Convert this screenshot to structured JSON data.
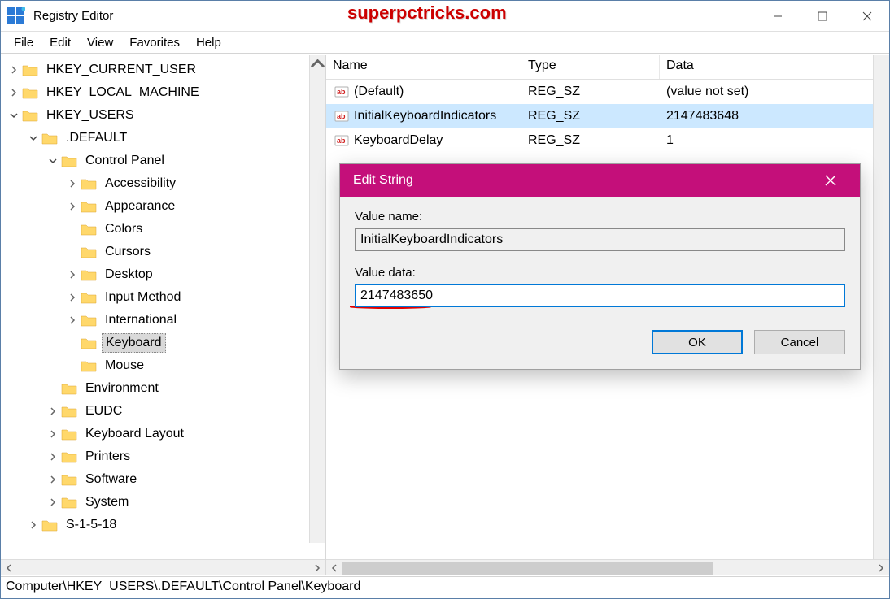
{
  "header": {
    "title": "Registry Editor",
    "watermark": "superpctricks.com"
  },
  "menu": {
    "file": "File",
    "edit": "Edit",
    "view": "View",
    "favorites": "Favorites",
    "help": "Help"
  },
  "tree": {
    "hkcu": "HKEY_CURRENT_USER",
    "hklm": "HKEY_LOCAL_MACHINE",
    "hku": "HKEY_USERS",
    "default": ".DEFAULT",
    "cp": "Control Panel",
    "cp_items": [
      "Accessibility",
      "Appearance",
      "Colors",
      "Cursors",
      "Desktop",
      "Input Method",
      "International",
      "Keyboard",
      "Mouse"
    ],
    "env": "Environment",
    "eudc": "EUDC",
    "kbl": "Keyboard Layout",
    "printers": "Printers",
    "software": "Software",
    "system": "System",
    "s1518": "S-1-5-18"
  },
  "list": {
    "cols": {
      "name": "Name",
      "type": "Type",
      "data": "Data"
    },
    "rows": [
      {
        "name": "(Default)",
        "type": "REG_SZ",
        "data": "(value not set)",
        "sel": false
      },
      {
        "name": "InitialKeyboardIndicators",
        "type": "REG_SZ",
        "data": "2147483648",
        "sel": true
      },
      {
        "name": "KeyboardDelay",
        "type": "REG_SZ",
        "data": "1",
        "sel": false
      }
    ]
  },
  "dialog": {
    "title": "Edit String",
    "value_name_label": "Value name:",
    "value_name": "InitialKeyboardIndicators",
    "value_data_label": "Value data:",
    "value_data": "2147483650",
    "ok": "OK",
    "cancel": "Cancel"
  },
  "status": {
    "path": "Computer\\HKEY_USERS\\.DEFAULT\\Control Panel\\Keyboard"
  }
}
